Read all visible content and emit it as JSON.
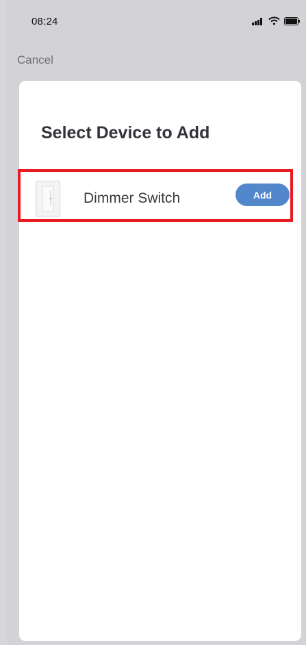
{
  "status_bar": {
    "time": "08:24",
    "icons": [
      "signal-icon",
      "wifi-icon",
      "battery-icon"
    ]
  },
  "nav": {
    "cancel_label": "Cancel"
  },
  "sheet": {
    "title": "Select Device to Add",
    "devices": [
      {
        "name": "Dimmer Switch",
        "icon": "dimmer-switch-icon",
        "action_label": "Add"
      }
    ]
  },
  "colors": {
    "background": "#d3d2d7",
    "sheet": "#ffffff",
    "add_button": "#5288cb",
    "highlight": "#e91a22",
    "title_text": "#33343a"
  }
}
